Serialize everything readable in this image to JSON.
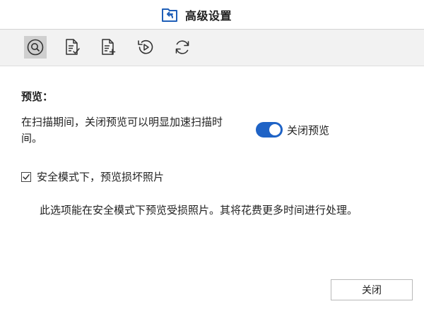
{
  "window": {
    "title": "高级设置",
    "app_icon": "back-arrow-folder-icon"
  },
  "toolbar": {
    "items": [
      {
        "icon": "magnify-circle-icon",
        "active": true
      },
      {
        "icon": "document-check-icon",
        "active": false
      },
      {
        "icon": "document-add-icon",
        "active": false
      },
      {
        "icon": "history-play-icon",
        "active": false
      },
      {
        "icon": "refresh-icon",
        "active": false
      }
    ]
  },
  "preview": {
    "section_title": "预览：",
    "description": "在扫描期间，关闭预览可以明显加速扫描时间。",
    "toggle_label": "关闭预览",
    "toggle_on": true
  },
  "safe_mode": {
    "checkbox_label": "安全模式下，预览损坏照片",
    "checked": true,
    "note": "此选项能在安全模式下预览受损照片。其将花费更多时间进行处理。"
  },
  "footer": {
    "close_label": "关闭"
  },
  "colors": {
    "accent": "#1f63c6",
    "toolbar_bg": "#f2f2f2",
    "active_tool_bg": "#cfcfcf"
  }
}
